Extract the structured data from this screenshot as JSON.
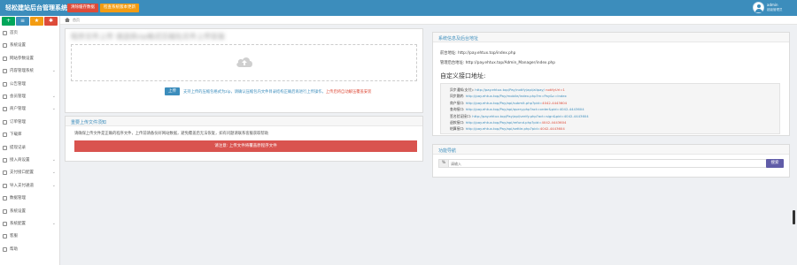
{
  "header": {
    "brand": "轻松建站后台管理系统",
    "btn_red": "清除缓存数据",
    "btn_orange": "检查系统版本更新",
    "user_name": "admin",
    "user_sub": "超级管理员"
  },
  "sidebar": {
    "quick_buttons": [
      {
        "icon": "plus-icon",
        "symbol": "+",
        "color": "#00a65a"
      },
      {
        "icon": "list-icon",
        "symbol": "≡",
        "color": "#3c8dbc"
      },
      {
        "icon": "star-icon",
        "symbol": "★",
        "color": "#f39c12"
      },
      {
        "icon": "settings-icon",
        "symbol": "✱",
        "color": "#dd4b39"
      }
    ],
    "items": [
      {
        "label": "首页",
        "chevron": ""
      },
      {
        "label": "系统设置",
        "chevron": ""
      },
      {
        "label": "网站参数设置",
        "chevron": ""
      },
      {
        "label": "内容管理系统",
        "chevron": "⌄"
      },
      {
        "label": "公告管理",
        "chevron": ""
      },
      {
        "label": "会员管理",
        "chevron": "⌄"
      },
      {
        "label": "商户管理",
        "chevron": "⌄"
      },
      {
        "label": "订单管理",
        "chevron": ""
      },
      {
        "label": "下载库",
        "chevron": ""
      },
      {
        "label": "提现记录",
        "chevron": ""
      },
      {
        "label": "接入商设置",
        "chevron": "⌄"
      },
      {
        "label": "支付接口配置",
        "chevron": "⌄"
      },
      {
        "label": "导入支付通道",
        "chevron": "⌄"
      },
      {
        "label": "数据管理",
        "chevron": ""
      },
      {
        "label": "系统设置",
        "chevron": ""
      },
      {
        "label": "系统配置",
        "chevron": "⌄"
      },
      {
        "label": "客服",
        "chevron": ""
      },
      {
        "label": "帮助",
        "chevron": ""
      }
    ]
  },
  "breadcrumb": {
    "text": "首页"
  },
  "upload_panel": {
    "blurred_title": "程序文件上传 请选择zip格式压缩包文件上传安装",
    "upload_button": "上传",
    "note": "支持上传的压缩包格式为zip，请确认压缩包内文件目录结构正确后再进行上传操作，",
    "note_warn": "上传后将自动解压覆盖安装"
  },
  "notice_panel": {
    "title": "重要上传文件须知",
    "text": "请确保上传文件是正确的程序文件，上传前请备份好网站数据，避免覆盖后无法恢复，如有问题请联系客服获取帮助",
    "warning": "请注意: 上传文件将覆盖原程序文件"
  },
  "info_panel": {
    "title": "系统信息及后台地址",
    "line1": "前台地址: http://pay.ehtux.top/index.php",
    "line2": "管理后台地址: http://pay.ehtux.top/Admin_Manager/index.php",
    "section": "自定义接口地址:",
    "code_lines": [
      {
        "k": "异步通知(支付): ",
        "v": "http://pay.ehtux.top/Pay/notify/api/alipay/",
        "t": "   notifyUrl=1"
      },
      {
        "k": "同步跳转: ",
        "v": "http://pay.ehtux.top/Pay/mobile/index.php?m=Pay&c=Index",
        "t": ""
      },
      {
        "k": "商户接口: ",
        "v": "http://pay.ehtux.top/Pay/api/submit.php?pid=",
        "t": "4042-4443604"
      },
      {
        "k": "查询接口: ",
        "v": "http://pay.ehtux.top/Pay/api/query.php?act=order&pid=4042-4443604",
        "t": ""
      },
      {
        "k": "签名验证接口: ",
        "v": "http://pay.ehtux.top/Pay/api/verify.php?act=sign&pid=4042-4443604",
        "t": ""
      },
      {
        "k": "退款接口: ",
        "v": "http://pay.ehtux.top/Pay/api/refund.php?pid=",
        "t": "4042-4443604"
      },
      {
        "k": "结算接口: ",
        "v": "http://pay.ehtux.top/Pay/api/settle.php?pid=",
        "t": "4042-4443604"
      }
    ]
  },
  "search_panel": {
    "title": "功能导航",
    "addon": "%",
    "placeholder": "请输入",
    "button": "搜索"
  }
}
